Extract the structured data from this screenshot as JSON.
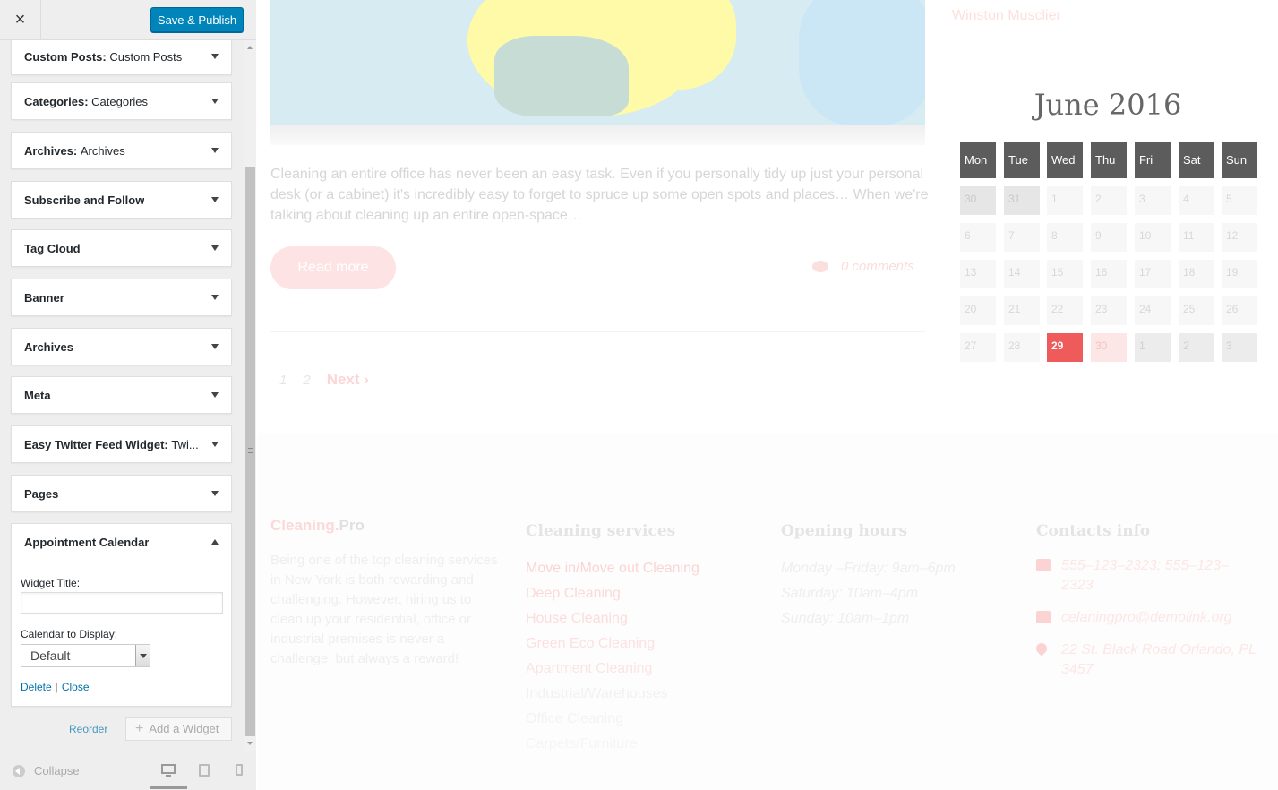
{
  "header": {
    "close_label": "×",
    "publish_label": "Save & Publish"
  },
  "widgets": [
    {
      "name": "Custom Posts",
      "subtitle": "Custom Posts"
    },
    {
      "name": "Categories",
      "subtitle": "Categories"
    },
    {
      "name": "Archives",
      "subtitle": "Archives"
    },
    {
      "name": "Subscribe and Follow",
      "subtitle": ""
    },
    {
      "name": "Tag Cloud",
      "subtitle": ""
    },
    {
      "name": "Banner",
      "subtitle": ""
    },
    {
      "name": "Archives",
      "subtitle": ""
    },
    {
      "name": "Meta",
      "subtitle": ""
    },
    {
      "name": "Easy Twitter Feed Widget",
      "subtitle": "Twi..."
    },
    {
      "name": "Pages",
      "subtitle": ""
    }
  ],
  "open_widget": {
    "name": "Appointment Calendar",
    "title_label": "Widget Title:",
    "title_value": "",
    "calendar_label": "Calendar to Display:",
    "calendar_value": "Default",
    "delete_label": "Delete",
    "separator": "|",
    "close_label": "Close"
  },
  "sidebar_actions": {
    "reorder_label": "Reorder",
    "add_widget_label": "Add a Widget"
  },
  "footer_bar": {
    "collapse_label": "Collapse",
    "icons": [
      "desktop-icon",
      "tablet-icon",
      "mobile-icon"
    ]
  },
  "post": {
    "excerpt": "Cleaning an entire office has never been an easy task. Even if you personally tidy up just your personal desk (or a cabinet) it's incredibly easy to forget to spruce up some open spots and places… When we're talking about cleaning up an entire open-space…",
    "read_more": "Read more",
    "comments": "0 comments"
  },
  "pagination": {
    "pages": [
      "1",
      "2"
    ],
    "next_label": "Next"
  },
  "author": "Winston Musclier",
  "calendar": {
    "title": "June 2016",
    "weekdays": [
      "Mon",
      "Tue",
      "Wed",
      "Thu",
      "Fri",
      "Sat",
      "Sun"
    ],
    "weeks": [
      [
        "30",
        "31",
        "1",
        "2",
        "3",
        "4",
        "5"
      ],
      [
        "6",
        "7",
        "8",
        "9",
        "10",
        "11",
        "12"
      ],
      [
        "13",
        "14",
        "15",
        "16",
        "17",
        "18",
        "19"
      ],
      [
        "20",
        "21",
        "22",
        "23",
        "24",
        "25",
        "26"
      ],
      [
        "27",
        "28",
        "29",
        "30",
        "1",
        "2",
        "3"
      ]
    ],
    "today": "29",
    "accent_color": "#ef5b5b"
  },
  "footer": {
    "logo_main": "Cleaning.",
    "logo_suffix": "Pro",
    "about": "Being one of the top cleaning services in New York is both rewarding and challenging. However, hiring us to clean up your residential, office or industrial premises is never a challenge, but always a reward!",
    "services_heading": "Cleaning services",
    "services": [
      "Move in/Move out Cleaning",
      "Deep Cleaning",
      "House Cleaning",
      "Green Eco Cleaning",
      "Apartment Cleaning",
      "Industrial/Warehouses",
      "Office Cleaning",
      "Carpets/Furniture"
    ],
    "hours_heading": "Opening hours",
    "hours": [
      "Monday –Friday: 9am–6pm",
      "Saturday: 10am–4pm",
      "Sunday: 10am–1pm"
    ],
    "contacts_heading": "Contacts info",
    "phone": "555–123–2323; 555–123–2323",
    "email": "celaningpro@demolink.org",
    "address": "22 St. Black Road Orlando, PL 3457"
  }
}
